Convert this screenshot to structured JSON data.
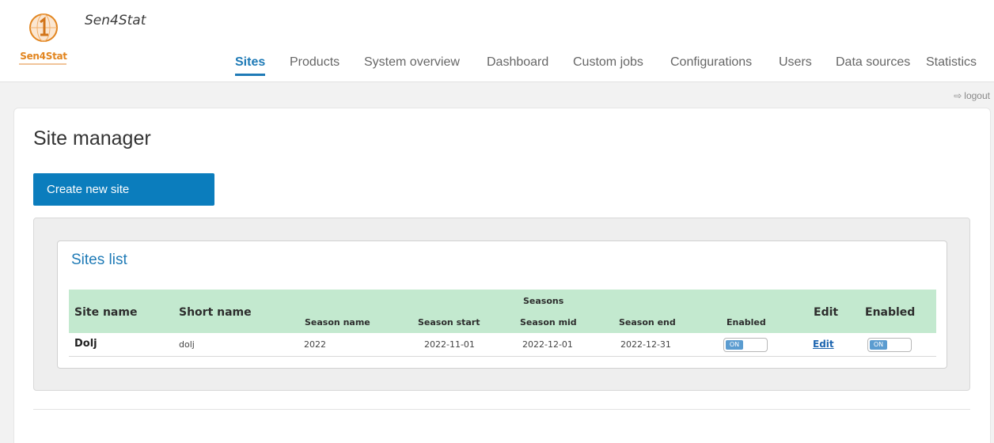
{
  "header": {
    "app_name": "Sen4Stat",
    "logo_text": "Sen4Stat",
    "nav": [
      {
        "label": "Sites",
        "active": true
      },
      {
        "label": "Products",
        "active": false
      },
      {
        "label": "System overview",
        "active": false
      },
      {
        "label": "Dashboard",
        "active": false
      },
      {
        "label": "Custom jobs",
        "active": false
      },
      {
        "label": "Configurations",
        "active": false
      },
      {
        "label": "Users",
        "active": false
      },
      {
        "label": "Data sources",
        "active": false
      },
      {
        "label": "Statistics",
        "active": false
      }
    ],
    "logout_label": "logout"
  },
  "page": {
    "title": "Site manager",
    "create_button": "Create new site"
  },
  "sites_list": {
    "title": "Sites list",
    "columns": {
      "site_name": "Site name",
      "short_name": "Short name",
      "seasons": "Seasons",
      "season_name": "Season name",
      "season_start": "Season start",
      "season_mid": "Season mid",
      "season_end": "Season end",
      "season_enabled": "Enabled",
      "edit": "Edit",
      "enabled": "Enabled"
    },
    "rows": [
      {
        "site_name": "Dolj",
        "short_name": "dolj",
        "season_name": "2022",
        "season_start": "2022-11-01",
        "season_mid": "2022-12-01",
        "season_end": "2022-12-31",
        "season_enabled": "ON",
        "edit": "Edit",
        "enabled": "ON"
      }
    ]
  },
  "colors": {
    "accent": "#1e7ab6",
    "button": "#0b7dbd",
    "table_header": "#c3e9cf",
    "logo": "#e2851f"
  }
}
